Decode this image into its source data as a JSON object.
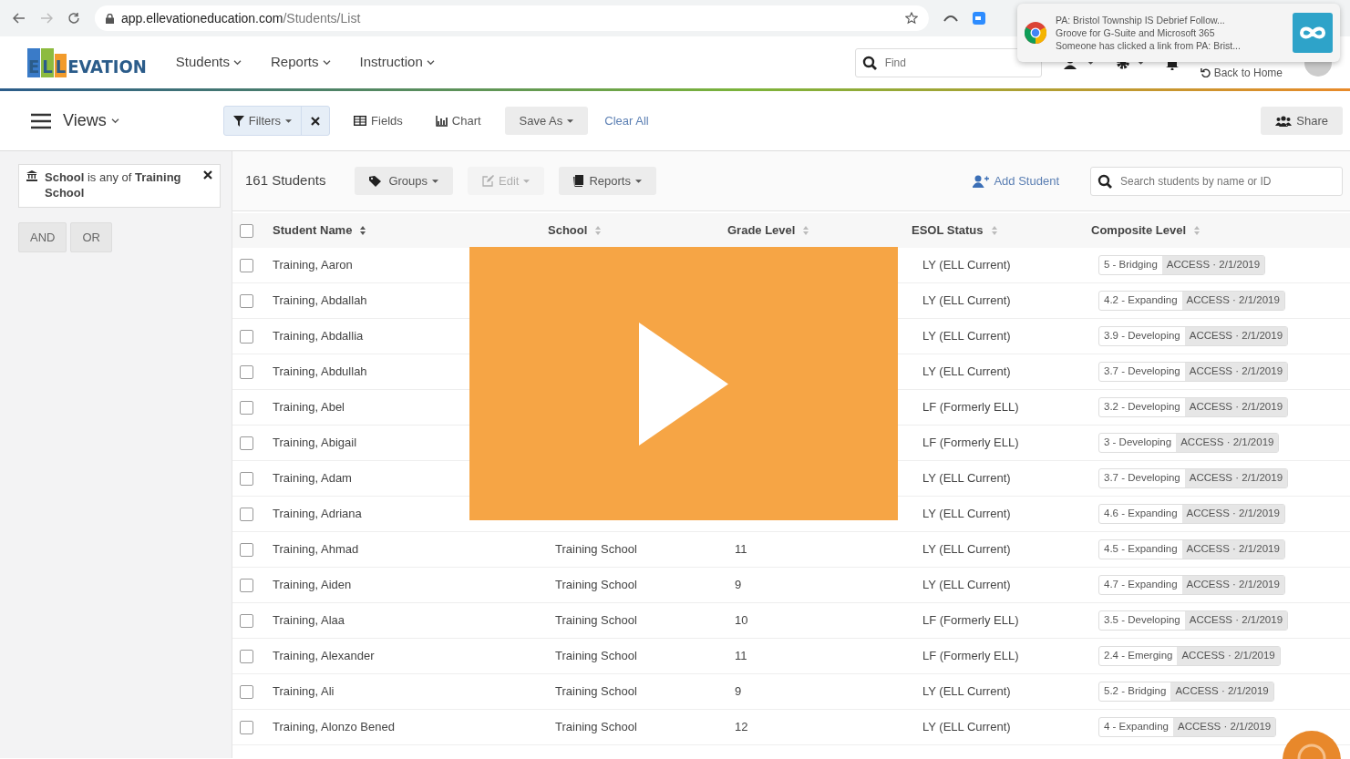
{
  "browser": {
    "url_host": "app.ellevationeducation.com",
    "url_path": "/Students/List"
  },
  "notification": {
    "title": "PA: Bristol Township IS Debrief Follow...",
    "subtitle": "Groove for G-Suite and Microsoft 365",
    "message": "Someone has clicked a link from PA: Brist..."
  },
  "navbar": {
    "logo": [
      "E",
      "L",
      "L",
      "EVATION"
    ],
    "menus": [
      "Students",
      "Reports",
      "Instruction"
    ],
    "search_placeholder": "Find",
    "back_link": "Back to Home"
  },
  "toolbar": {
    "views": "Views",
    "filters": "Filters",
    "fields": "Fields",
    "chart": "Chart",
    "save_as": "Save As",
    "clear": "Clear All",
    "share": "Share"
  },
  "filter": {
    "text": "**School** is any of **Training School**",
    "operators": [
      "AND",
      "OR"
    ]
  },
  "list_toolbar": {
    "count": "161 Students",
    "groups": "Groups",
    "edit": {
      "label": "Edit",
      "disabled": true
    },
    "reports": "Reports",
    "add": "Add Student",
    "search_placeholder": "Search students by name or ID"
  },
  "table": {
    "header_checked": false,
    "columns": [
      {
        "label": "Student Name",
        "sorted": true
      },
      {
        "label": "School",
        "sorted": false
      },
      {
        "label": "Grade Level",
        "sorted": false
      },
      {
        "label": "ESOL Status",
        "sorted": false
      },
      {
        "label": "Composite Level",
        "sorted": false
      }
    ],
    "rows": [
      {
        "checked": false,
        "name": "Training, Aaron",
        "esol": "LY (ELL Current)",
        "level": "5 - Bridging",
        "assessment": "ACCESS · 2/1/2019"
      },
      {
        "checked": false,
        "name": "Training, Abdallah",
        "esol": "LY (ELL Current)",
        "level": "4.2 - Expanding",
        "assessment": "ACCESS · 2/1/2019"
      },
      {
        "checked": false,
        "name": "Training, Abdallia",
        "esol": "LY (ELL Current)",
        "level": "3.9 - Developing",
        "assessment": "ACCESS · 2/1/2019"
      },
      {
        "checked": false,
        "name": "Training, Abdullah",
        "esol": "LY (ELL Current)",
        "level": "3.7 - Developing",
        "assessment": "ACCESS · 2/1/2019"
      },
      {
        "checked": false,
        "name": "Training, Abel",
        "esol": "LF (Formerly ELL)",
        "level": "3.2 - Developing",
        "assessment": "ACCESS · 2/1/2019"
      },
      {
        "checked": false,
        "name": "Training, Abigail",
        "esol": "LF (Formerly ELL)",
        "level": "3 - Developing",
        "assessment": "ACCESS · 2/1/2019"
      },
      {
        "checked": false,
        "name": "Training, Adam",
        "esol": "LY (ELL Current)",
        "level": "3.7 - Developing",
        "assessment": "ACCESS · 2/1/2019"
      },
      {
        "checked": false,
        "name": "Training, Adriana",
        "esol": "LY (ELL Current)",
        "level": "4.6 - Expanding",
        "assessment": "ACCESS · 2/1/2019"
      },
      {
        "checked": false,
        "name": "Training, Ahmad",
        "school": "Training School",
        "grade": "11",
        "esol": "LY (ELL Current)",
        "level": "4.5 - Expanding",
        "assessment": "ACCESS · 2/1/2019"
      },
      {
        "checked": false,
        "name": "Training, Aiden",
        "school": "Training School",
        "grade": "9",
        "esol": "LY (ELL Current)",
        "level": "4.7 - Expanding",
        "assessment": "ACCESS · 2/1/2019"
      },
      {
        "checked": false,
        "name": "Training, Alaa",
        "school": "Training School",
        "grade": "10",
        "esol": "LF (Formerly ELL)",
        "level": "3.5 - Developing",
        "assessment": "ACCESS · 2/1/2019"
      },
      {
        "checked": false,
        "name": "Training, Alexander",
        "school": "Training School",
        "grade": "11",
        "esol": "LF (Formerly ELL)",
        "level": "2.4 - Emerging",
        "assessment": "ACCESS · 2/1/2019"
      },
      {
        "checked": false,
        "name": "Training, Ali",
        "school": "Training School",
        "grade": "9",
        "esol": "LY (ELL Current)",
        "level": "5.2 - Bridging",
        "assessment": "ACCESS · 2/1/2019"
      },
      {
        "checked": false,
        "name": "Training, Alonzo Bened",
        "school": "Training School",
        "grade": "12",
        "esol": "LY (ELL Current)",
        "level": "4 - Expanding",
        "assessment": "ACCESS · 2/1/2019"
      }
    ]
  }
}
